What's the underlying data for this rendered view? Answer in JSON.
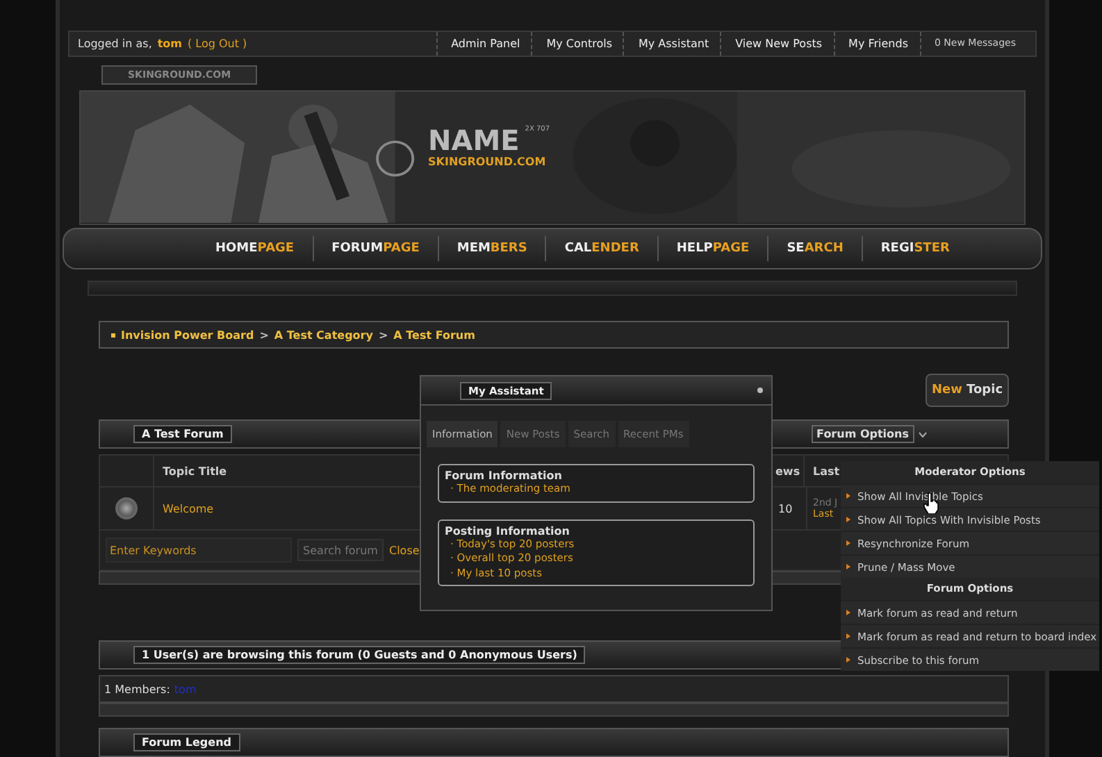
{
  "top_bar": {
    "logged_in_label": "Logged in as,",
    "username": "tom",
    "logout": "( Log Out )",
    "links": [
      {
        "label": "Admin Panel"
      },
      {
        "label": "My Controls"
      },
      {
        "label": "My Assistant"
      },
      {
        "label": "View New Posts"
      },
      {
        "label": "My Friends"
      },
      {
        "label": "0 New Messages",
        "kind": "small"
      }
    ]
  },
  "site_tab": "SKINGROUND.COM",
  "banner": {
    "logo": "NAME",
    "logo_small": "2X 707",
    "site": "SKINGROUND.COM"
  },
  "nav": [
    {
      "main": "HOME",
      "accent": "PAGE"
    },
    {
      "main": "FORUM",
      "accent": "PAGE"
    },
    {
      "main": "MEM",
      "accent": "BERS"
    },
    {
      "main": "CAL",
      "accent": "ENDER"
    },
    {
      "main": "HELP",
      "accent": "PAGE"
    },
    {
      "main": "SE",
      "accent": "ARCH"
    },
    {
      "main": "REGI",
      "accent": "STER"
    }
  ],
  "breadcrumb": [
    "Invision Power Board",
    "A Test Category",
    "A Test Forum"
  ],
  "breadcrumb_sep": ">",
  "new_topic": {
    "main": "New",
    "accent": " Topic"
  },
  "forum": {
    "title": "A Test Forum",
    "options_label": "Forum Options",
    "columns": [
      "Topic Title",
      "ews",
      "Last"
    ],
    "rows": [
      {
        "title": "Welcome",
        "views": "10",
        "last_date": "2nd J",
        "last_link": "Last"
      }
    ],
    "search_placeholder": "Enter Keywords",
    "search_button": "Search forum",
    "close_label": "Close"
  },
  "assistant": {
    "title": "My Assistant",
    "tabs": [
      {
        "label": "Information",
        "selected": true
      },
      {
        "label": "New Posts",
        "selected": false
      },
      {
        "label": "Search",
        "selected": false
      },
      {
        "label": "Recent PMs",
        "selected": false
      }
    ],
    "sections": [
      {
        "heading": "Forum Information",
        "links": [
          "· The moderating team"
        ]
      },
      {
        "heading": "Posting Information",
        "links": [
          "· Today's top 20 posters",
          "· Overall top 20 posters",
          "· My last 10 posts"
        ]
      }
    ]
  },
  "options_menu": [
    {
      "kind": "header",
      "label": "Moderator Options"
    },
    {
      "kind": "item",
      "label": "Show All Invisible Topics"
    },
    {
      "kind": "item",
      "label": "Show All Topics With Invisible Posts"
    },
    {
      "kind": "item",
      "label": "Resynchronize Forum"
    },
    {
      "kind": "item",
      "label": "Prune / Mass Move"
    },
    {
      "kind": "header",
      "label": "Forum Options"
    },
    {
      "kind": "item",
      "label": "Mark forum as read and return"
    },
    {
      "kind": "item",
      "label": "Mark forum as read and return to board index"
    },
    {
      "kind": "item",
      "label": "Subscribe to this forum"
    }
  ],
  "browsing": {
    "title": "1 User(s) are browsing this forum (0 Guests and 0 Anonymous Users)",
    "members_label": "1 Members:",
    "member": "tom"
  },
  "legend": {
    "title": "Forum Legend"
  }
}
